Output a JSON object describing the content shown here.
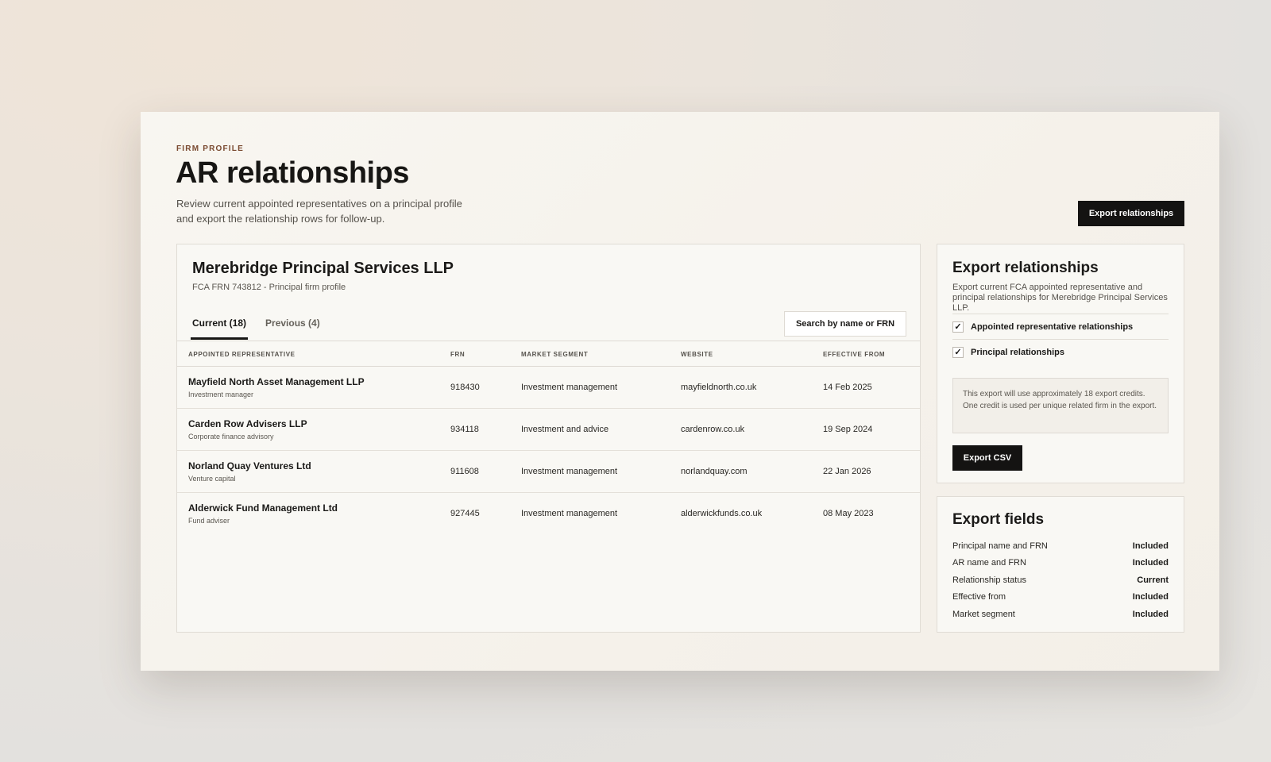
{
  "header": {
    "eyebrow": "FIRM PROFILE",
    "title": "AR relationships",
    "description": "Review current appointed representatives on a principal profile and export the relationship rows for follow-up.",
    "export_button": "Export relationships"
  },
  "firm": {
    "name": "Merebridge Principal Services LLP",
    "subtitle": "FCA FRN 743812 - Principal firm profile"
  },
  "tabs": [
    {
      "label": "Current (18)",
      "active": true
    },
    {
      "label": "Previous (4)",
      "active": false
    }
  ],
  "search": {
    "label": "Search by name or FRN"
  },
  "table": {
    "columns": [
      "APPOINTED REPRESENTATIVE",
      "FRN",
      "MARKET SEGMENT",
      "WEBSITE",
      "EFFECTIVE FROM"
    ],
    "rows": [
      {
        "name": "Mayfield North Asset Management LLP",
        "type": "Investment manager",
        "frn": "918430",
        "segment": "Investment management",
        "website": "mayfieldnorth.co.uk",
        "effective": "14 Feb 2025"
      },
      {
        "name": "Carden Row Advisers LLP",
        "type": "Corporate finance advisory",
        "frn": "934118",
        "segment": "Investment and advice",
        "website": "cardenrow.co.uk",
        "effective": "19 Sep 2024"
      },
      {
        "name": "Norland Quay Ventures Ltd",
        "type": "Venture capital",
        "frn": "911608",
        "segment": "Investment management",
        "website": "norlandquay.com",
        "effective": "22 Jan 2026"
      },
      {
        "name": "Alderwick Fund Management Ltd",
        "type": "Fund adviser",
        "frn": "927445",
        "segment": "Investment management",
        "website": "alderwickfunds.co.uk",
        "effective": "08 May 2023"
      }
    ]
  },
  "export_panel": {
    "title": "Export relationships",
    "description": "Export current FCA appointed representative and principal relationships for Merebridge Principal Services LLP.",
    "options": [
      {
        "label": "Appointed representative relationships",
        "checked": true
      },
      {
        "label": "Principal relationships",
        "checked": true
      }
    ],
    "check_mark": "✓",
    "notice": "This export will use approximately 18 export credits. One credit is used per unique related firm in the export.",
    "button": "Export CSV"
  },
  "fields_panel": {
    "title": "Export fields",
    "fields": [
      {
        "label": "Principal name and FRN",
        "value": "Included"
      },
      {
        "label": "AR name and FRN",
        "value": "Included"
      },
      {
        "label": "Relationship status",
        "value": "Current"
      },
      {
        "label": "Effective from",
        "value": "Included"
      },
      {
        "label": "Market segment",
        "value": "Included"
      }
    ]
  }
}
